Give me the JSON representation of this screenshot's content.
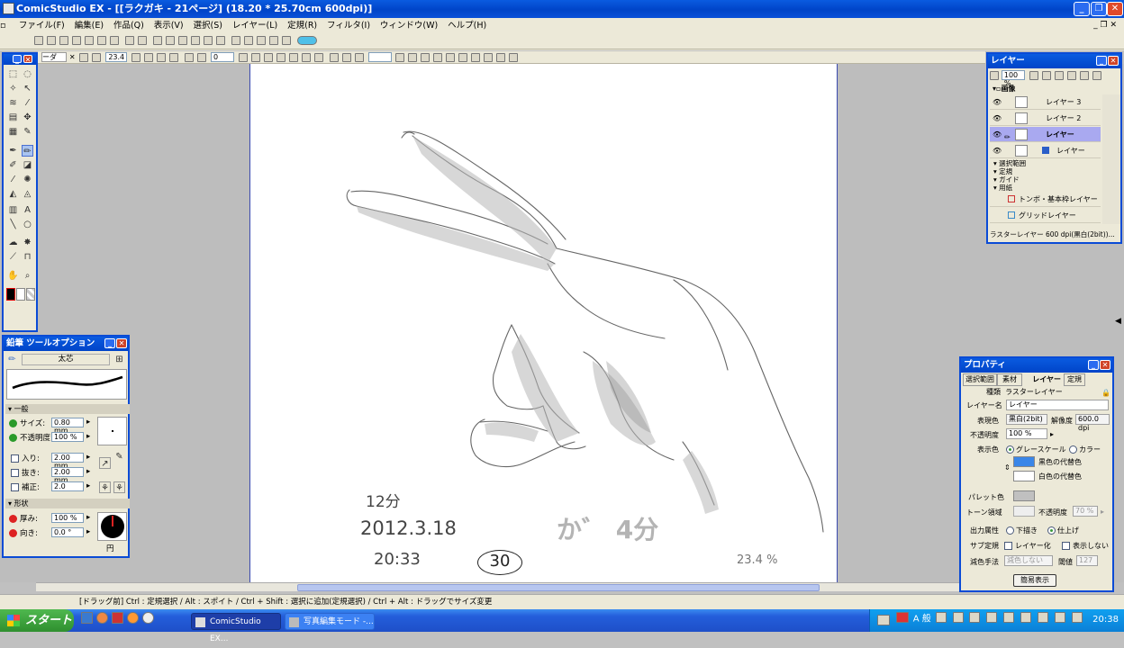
{
  "window": {
    "title": "ComicStudio EX - [[ラクガキ - 21ページ] (18.20 * 25.70cm 600dpi)]"
  },
  "menu": [
    "ファイル(F)",
    "編集(E)",
    "作品(Q)",
    "表示(V)",
    "選択(S)",
    "レイヤー(L)",
    "定規(R)",
    "フィルタ(I)",
    "ウィンドウ(W)",
    "ヘルプ(H)"
  ],
  "toolbar2": {
    "tab_label": "ーダ",
    "zoom": "23.4",
    "rotate": "0"
  },
  "tool_options": {
    "title": "鉛筆 ツールオプション",
    "brush_name": "太芯",
    "section_general": "一般",
    "size_label": "サイズ:",
    "size_value": "0.80 mm",
    "opacity_label": "不透明度:",
    "opacity_value": "100 %",
    "in_label": "入り:",
    "in_value": "2.00 mm",
    "out_label": "抜き:",
    "out_value": "2.00 mm",
    "correct_label": "補正:",
    "correct_value": "2.0",
    "section_shape": "形状",
    "thickness_label": "厚み:",
    "thickness_value": "100 %",
    "direction_label": "向き:",
    "direction_value": "0.0 °",
    "shape_name": "円"
  },
  "layer_panel": {
    "title": "レイヤー",
    "opacity": "100 %",
    "group_label": "画像",
    "layers": [
      {
        "name": "レイヤー 3"
      },
      {
        "name": "レイヤー 2"
      },
      {
        "name": "レイヤー"
      },
      {
        "name": "レイヤー"
      }
    ],
    "sections": [
      "選択範囲",
      "定規",
      "ガイド",
      "用紙"
    ],
    "paper_layers": [
      {
        "name": "トンボ・基本枠レイヤー"
      },
      {
        "name": "グリッドレイヤー"
      }
    ],
    "status": "ラスターレイヤー 600 dpi(黒白(2bit))..."
  },
  "properties": {
    "title": "プロパティ",
    "tabs": [
      "選択範囲",
      "素材",
      "レイヤー",
      "定規"
    ],
    "kind_label": "種類",
    "kind_value": "ラスターレイヤー",
    "name_label": "レイヤー名",
    "name_value": "レイヤー",
    "expr_label": "表現色",
    "expr_value": "黒白(2bit)",
    "res_label": "解像度",
    "res_value": "600.0 dpi",
    "opacity_label": "不透明度",
    "opacity_value": "100 %",
    "display_label": "表示色",
    "display_grey": "グレースケール",
    "display_color": "カラー",
    "black_sub": "黒色の代替色",
    "white_sub": "白色の代替色",
    "palette_label": "パレット色",
    "tone_label": "トーン領域",
    "tone_opacity_label": "不透明度",
    "tone_opacity_value": "70 %",
    "output_label": "出力属性",
    "output_draft": "下描き",
    "output_final": "仕上げ",
    "sub_label": "サブ定規",
    "sub_layerize": "レイヤー化",
    "sub_hide": "表示しない",
    "dither_label": "減色手法",
    "dither_value": "減色しない",
    "threshold_label": "閾値",
    "threshold_value": "127",
    "simple_button": "簡易表示",
    "colors": {
      "black_sub": "#3a86e8",
      "white_sub": "#ffffff",
      "palette": "#c0c0c0"
    }
  },
  "sketch": {
    "time1": "12分",
    "date": "2012.3.18",
    "time2": "20:33",
    "circle_num": "30",
    "kana": "か゛ 4分",
    "zoom": "23.4 %"
  },
  "statusbar": "[ドラッグ前] Ctrl : 定規選択 / Alt : スポイト / Ctrl + Shift : 選択に追加(定規選択) / Ctrl + Alt : ドラッグでサイズ変更",
  "taskbar": {
    "start": "スタート",
    "tasks": [
      "ComicStudio EX...",
      "写真編集モード -..."
    ],
    "clock": "20:38",
    "ime": "A 般"
  }
}
